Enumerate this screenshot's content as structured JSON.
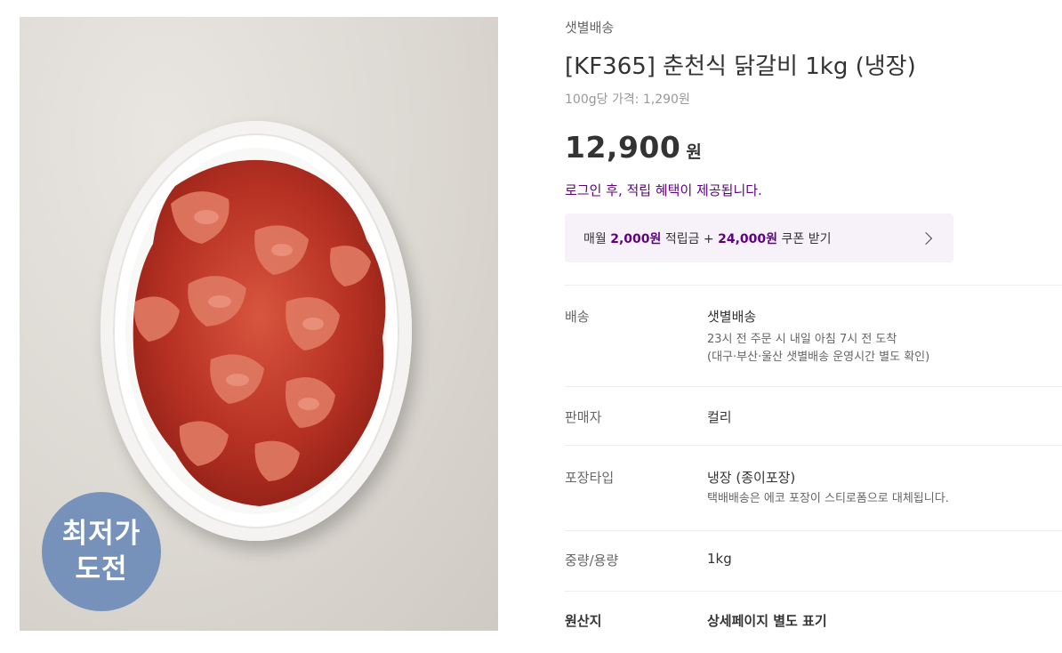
{
  "product": {
    "delivery_tag": "샛별배송",
    "title": "[KF365] 춘천식 닭갈비 1kg (냉장)",
    "unit_price": "100g당 가격: 1,290원",
    "price": "12,900",
    "price_unit": "원",
    "login_message": "로그인 후, 적립 혜택이 제공됩니다.",
    "badge_line1": "최저가",
    "badge_line2": "도전"
  },
  "coupon": {
    "prefix": "매월 ",
    "points": "2,000원",
    "middle": " 적립금 + ",
    "coupon_amount": "24,000원",
    "suffix": " 쿠폰 받기"
  },
  "details": [
    {
      "label": "배송",
      "value": "샛별배송",
      "sub1": "23시 전 주문 시 내일 아침 7시 전 도착",
      "sub2": "(대구·부산·울산 샛별배송 운영시간 별도 확인)"
    },
    {
      "label": "판매자",
      "value": "컬리"
    },
    {
      "label": "포장타입",
      "value": "냉장 (종이포장)",
      "sub1": "택배배송은 에코 포장이 스티로폼으로 대체됩니다."
    },
    {
      "label": "중량/용량",
      "value": "1kg"
    },
    {
      "label": "원산지",
      "value": "상세페이지 별도 표기"
    }
  ],
  "colors": {
    "accent": "#5f0080",
    "coupon_bg": "#f7f2fa",
    "badge": "#6e8cb9"
  }
}
